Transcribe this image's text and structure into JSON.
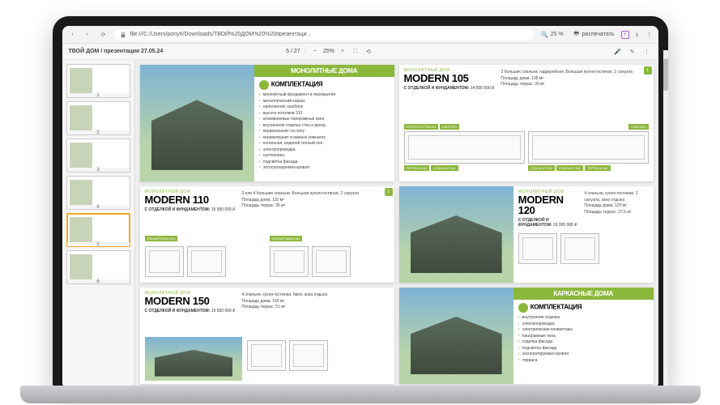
{
  "browser": {
    "url": "file:///C:/Users/ponyh/Downloads/ТВОЙ%20ДОМ%20%20презентаци...",
    "zoom_display": "25 %",
    "print_label": "распечатать"
  },
  "pdf": {
    "doc_title": "ТВОЙ ДОМ / презентация 27.05.24",
    "page_indicator": "5 / 27",
    "zoom": "25%",
    "thumbs": [
      {
        "n": "1"
      },
      {
        "n": "2"
      },
      {
        "n": "3"
      },
      {
        "n": "4"
      },
      {
        "n": "5"
      },
      {
        "n": "6"
      }
    ]
  },
  "slides": {
    "s1": {
      "banner": "МОНОЛИТНЫЕ ДОМА",
      "section_title": "КОМПЛЕКТАЦИЯ",
      "items": [
        "монолитный фундамент и перекрытия",
        "металлический каркас",
        "наполнение газоблок",
        "высота потолков 310",
        "алюминиевые панорамные окна",
        "внутренняя отделка стен и декор",
        "керамогранит на полу",
        "керамогранит в ванных комнатах",
        "котельная, водяной теплый пол",
        "электропроводка",
        "сантехника",
        "подсветка фасада",
        "эксплуатируемая кровля"
      ]
    },
    "s2": {
      "eyebrow": "МОНОЛИТНЫЙ ДОМ",
      "title": "MODERN 105",
      "price_line": "С ОТДЕЛКОЙ И ФУНДАМЕНТОМ:",
      "price": "14 500 000 ₽",
      "desc": "3 больших спальни, гардеробная. Большая кухня-гостиная, 2 санузла",
      "stats": [
        "Площадь дома: 105 м²",
        "Площадь террас: 30 м²"
      ],
      "rooms": [
        "КУХНЯ-ГОСТИНАЯ",
        "САНУЗЕЛ",
        "САНУЗЕЛ",
        "ТЕРРАСА №2",
        "СПАЛЬНЯ №1",
        "СПАЛЬНЯ №2",
        "СПАЛЬНЯ №3",
        "ТЕРРАСА №1"
      ]
    },
    "s3": {
      "eyebrow": "МОНОЛИТНЫЙ ДОМ",
      "title": "MODERN 110",
      "price_line": "С ОТДЕЛКОЙ И ФУНДАМЕНТОМ:",
      "price": "15 500 000 ₽",
      "desc": "3 или 4 большие спальни. Большая кухня-гостиная, 2 санузла",
      "stats": [
        "Площадь дома: 110 м²",
        "Площадь террас: 35 м²"
      ],
      "plan_labels": [
        "ПЛАНИРОВКА №1",
        "ПЛАНИРОВКА №2"
      ]
    },
    "s4": {
      "eyebrow": "МОНОЛИТНЫЙ ДОМ",
      "title": "MODERN 120",
      "price_line": "С ОТДЕЛКОЙ И ФУНДАМЕНТОМ:",
      "price": "16 000 000 ₽",
      "desc": "4 спальни, кухня-гостиная, 2 санузла, зона отдыха",
      "stats": [
        "Площадь дома: 120 м²",
        "Площадь террас: 37,5 м²"
      ]
    },
    "s5": {
      "eyebrow": "МОНОЛИТНЫЙ ДОМ",
      "title": "MODERN 150",
      "price_line": "С ОТДЕЛКОЙ И ФУНДАМЕНТОМ:",
      "price": "19 500 000 ₽",
      "desc": "4 спальни, кухня-гостиная, баня, зона отдыха",
      "stats": [
        "Площадь дома: 150 м²",
        "Площадь террас: 51 м²"
      ]
    },
    "s6": {
      "banner": "КАРКАСНЫЕ ДОМА",
      "section_title": "КОМПЛЕКТАЦИЯ",
      "items": [
        "внутренняя отделка",
        "электропроводка",
        "электрические конвекторы",
        "панорамные окна",
        "отделка фасада",
        "подсветка фасада",
        "эксплуатируемая кровля",
        "терраса"
      ]
    }
  }
}
